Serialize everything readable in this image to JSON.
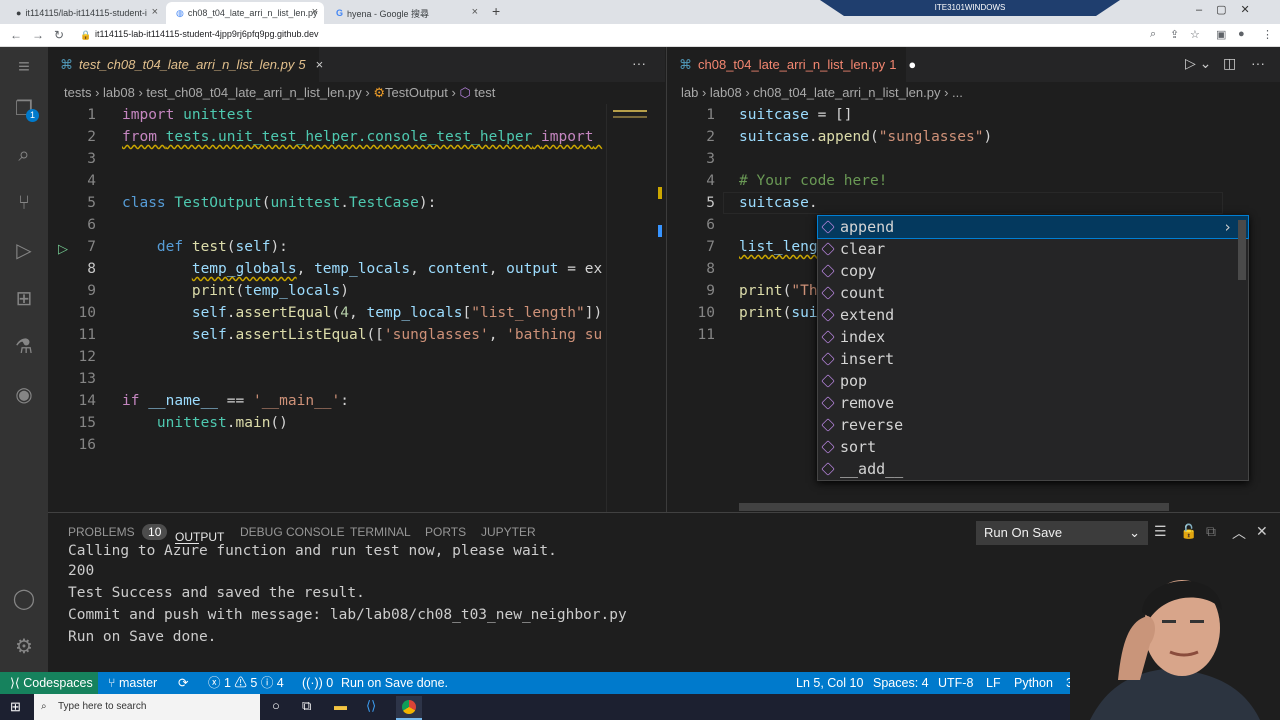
{
  "browser": {
    "tabs": [
      {
        "title": "it114115/lab-it114115-student-i"
      },
      {
        "title": "ch08_t04_late_arri_n_list_len.py"
      },
      {
        "title": "hyena - Google 搜尋"
      }
    ],
    "url": "it114115-lab-it114115-student-4jpp9rj6pfq9pg.github.dev",
    "remote_banner": "ITE3101WINDOWS"
  },
  "left_editor": {
    "tab_name": "test_ch08_t04_late_arri_n_list_len.py",
    "tab_badge": "5",
    "breadcrumbs": [
      "tests",
      "lab08",
      "test_ch08_t04_late_arri_n_list_len.py",
      "TestOutput",
      "test"
    ],
    "line_numbers": [
      "1",
      "2",
      "3",
      "4",
      "5",
      "6",
      "7",
      "8",
      "9",
      "10",
      "11",
      "12",
      "13",
      "14",
      "15",
      "16"
    ]
  },
  "right_editor": {
    "tab_name": "ch08_t04_late_arri_n_list_len.py",
    "tab_badge": "1",
    "breadcrumbs": [
      "lab",
      "lab08",
      "ch08_t04_late_arri_n_list_len.py",
      "..."
    ],
    "line_numbers": [
      "1",
      "2",
      "3",
      "4",
      "5",
      "6",
      "7",
      "8",
      "9",
      "10",
      "11"
    ]
  },
  "suggestions": [
    "append",
    "clear",
    "copy",
    "count",
    "extend",
    "index",
    "insert",
    "pop",
    "remove",
    "reverse",
    "sort",
    "__add__"
  ],
  "panel": {
    "tabs": [
      "PROBLEMS",
      "OUTPUT",
      "DEBUG CONSOLE",
      "TERMINAL",
      "PORTS",
      "JUPYTER"
    ],
    "problems_count": "10",
    "dropdown": "Run On Save",
    "lines": [
      "Calling to Azure function and run test now, please wait.",
      "200",
      "Test Success and saved the result.",
      "Commit and push with message: lab/lab08/ch08_t03_new_neighbor.py",
      "Run on Save done."
    ]
  },
  "status": {
    "remote": "Codespaces",
    "branch": "master",
    "errors": "1",
    "warnings": "5",
    "info": "4",
    "ports": "0",
    "message": "Run on Save done.",
    "position": "Ln 5, Col 10",
    "spaces": "Spaces: 4",
    "encoding": "UTF-8",
    "eol": "LF",
    "language": "Python",
    "version": "3.10"
  },
  "taskbar": {
    "search_placeholder": "Type here to search"
  },
  "colors": {
    "accent": "#007acc",
    "remote": "#16825d",
    "panel_bg": "#1e1e1e"
  }
}
